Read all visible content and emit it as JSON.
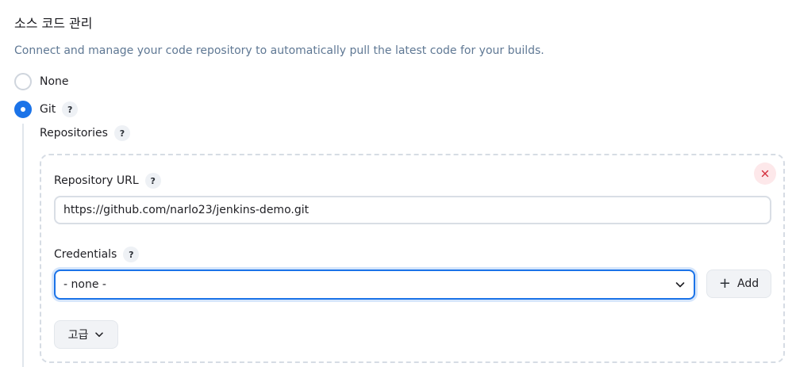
{
  "section": {
    "title": "소스 코드 관리",
    "description": "Connect and manage your code repository to automatically pull the latest code for your builds."
  },
  "scm_options": [
    {
      "label": "None",
      "selected": false
    },
    {
      "label": "Git",
      "selected": true,
      "help": "?"
    }
  ],
  "git": {
    "repositories_label": "Repositories",
    "repositories_help": "?",
    "repository": {
      "delete_icon": "close-icon",
      "url_label": "Repository URL",
      "url_help": "?",
      "url_value": "https://github.com/narlo23/jenkins-demo.git",
      "credentials_label": "Credentials",
      "credentials_help": "?",
      "credentials_selected": "- none -",
      "add_label": "Add",
      "add_icon": "plus-icon",
      "advanced_label": "고급"
    }
  },
  "colors": {
    "accent": "#1b73e8",
    "description": "#5f7894",
    "danger": "#d32f3c",
    "danger_bg": "#fde8ea"
  }
}
